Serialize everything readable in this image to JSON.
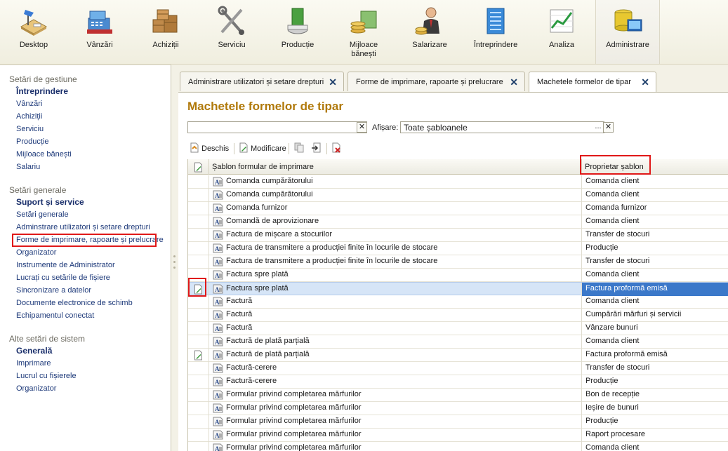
{
  "sections": [
    {
      "label": "Desktop",
      "icon": "desktop-icon"
    },
    {
      "label": "Vânzări",
      "icon": "cash-register-icon"
    },
    {
      "label": "Achiziții",
      "icon": "boxes-icon"
    },
    {
      "label": "Serviciu",
      "icon": "tools-icon"
    },
    {
      "label": "Producție",
      "icon": "production-roll-icon"
    },
    {
      "label": "Mijloace\nbănești",
      "icon": "coins-icon"
    },
    {
      "label": "Salarizare",
      "icon": "person-coins-icon"
    },
    {
      "label": "Întreprindere",
      "icon": "building-icon"
    },
    {
      "label": "Analiza",
      "icon": "chart-icon"
    },
    {
      "label": "Administrare",
      "icon": "database-icon",
      "active": true
    }
  ],
  "sidebar": {
    "group1_title": "Setări de gestiune",
    "group1_items": [
      "Întreprindere",
      "Vânzări",
      "Achiziții",
      "Serviciu",
      "Producție",
      "Mijloace bănești",
      "Salariu"
    ],
    "group2_title": "Setări generale",
    "group2_items": [
      "Suport și service",
      "Setări generale",
      "Adminstrare utilizatori și setare drepturi",
      "Forme de imprimare, rapoarte și prelucrare",
      "Organizator",
      "Instrumente de Administrator",
      "Lucrați cu setările de fișiere",
      "Sincronizare a datelor",
      "Documente electronice de schimb",
      "Echipamentul conectat"
    ],
    "group3_title": "Alte setări de sistem",
    "group3_items": [
      "Generală",
      "Imprimare",
      "Lucrul cu fișierele",
      "Organizator"
    ]
  },
  "tabs": [
    {
      "label": "Administrare utilizatori și setare drepturi"
    },
    {
      "label": "Forme de imprimare, rapoarte și prelucrare"
    },
    {
      "label": "Machetele formelor de tipar",
      "active": true
    }
  ],
  "page": {
    "title": "Machetele formelor de tipar",
    "search_value": "",
    "filter_label": "Afișare:",
    "filter_value": "Toate șabloanele"
  },
  "toolbar": {
    "open_label": "Deschis",
    "modify_label": "Modificare"
  },
  "table": {
    "col_template": "Șablon formular de imprimare",
    "col_owner": "Proprietar șablon",
    "rows": [
      {
        "name": "Comanda cumpărătorului",
        "owner": "Comanda client",
        "changed": false
      },
      {
        "name": "Comanda cumpărătorului",
        "owner": "Comanda client",
        "changed": false
      },
      {
        "name": "Comanda furnizor",
        "owner": "Comanda furnizor",
        "changed": false
      },
      {
        "name": "Comandă de aprovizionare",
        "owner": "Comanda client",
        "changed": false
      },
      {
        "name": "Factura de mișcare a stocurilor",
        "owner": "Transfer de stocuri",
        "changed": false
      },
      {
        "name": "Factura de transmitere a producției finite în locurile de stocare",
        "owner": "Producție",
        "changed": false
      },
      {
        "name": "Factura de transmitere a producției finite în locurile de stocare",
        "owner": "Transfer de stocuri",
        "changed": false
      },
      {
        "name": "Factura spre plată",
        "owner": "Comanda client",
        "changed": false
      },
      {
        "name": "Factura spre plată",
        "owner": "Factura proformă emisă",
        "changed": true,
        "selected": true
      },
      {
        "name": "Factură",
        "owner": "Comanda client",
        "changed": false
      },
      {
        "name": "Factură",
        "owner": "Cumpărări mărfuri și servicii",
        "changed": false
      },
      {
        "name": "Factură",
        "owner": "Vânzare bunuri",
        "changed": false
      },
      {
        "name": "Factură de plată parțială",
        "owner": "Comanda client",
        "changed": false
      },
      {
        "name": "Factură de plată parțială",
        "owner": "Factura proformă emisă",
        "changed": true
      },
      {
        "name": "Factură-cerere",
        "owner": "Transfer de stocuri",
        "changed": false
      },
      {
        "name": "Factură-cerere",
        "owner": "Producție",
        "changed": false
      },
      {
        "name": "Formular privind completarea mărfurilor",
        "owner": "Bon de recepție",
        "changed": false
      },
      {
        "name": "Formular privind completarea mărfurilor",
        "owner": "Ieșire de bunuri",
        "changed": false
      },
      {
        "name": "Formular privind completarea mărfurilor",
        "owner": "Producție",
        "changed": false
      },
      {
        "name": "Formular privind completarea mărfurilor",
        "owner": "Raport procesare",
        "changed": false
      },
      {
        "name": "Formular privind completarea mărfurilor",
        "owner": "Comanda client",
        "changed": false
      }
    ]
  },
  "colors": {
    "title_gold": "#b0790a",
    "link_blue": "#1e3a7a",
    "selection_blue": "#3b78c9",
    "highlight_red": "#e01818"
  }
}
